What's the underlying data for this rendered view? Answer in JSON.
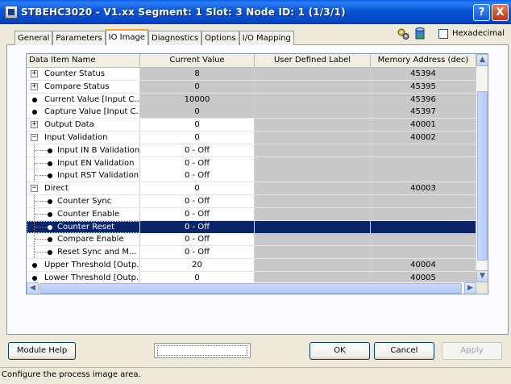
{
  "window": {
    "title": "STBEHC3020 - V1.xx Segment: 1 Slot: 3 Node ID: 1 (1/3/1)",
    "help_button": "?",
    "close_button": "X"
  },
  "tabs": [
    {
      "label": "General",
      "active": false
    },
    {
      "label": "Parameters",
      "active": false
    },
    {
      "label": "IO Image",
      "active": true
    },
    {
      "label": "Diagnostics",
      "active": false
    },
    {
      "label": "Options",
      "active": false
    },
    {
      "label": "I/O Mapping",
      "active": false
    }
  ],
  "toolbar": {
    "hexadecimal_label": "Hexadecimal",
    "hexadecimal_checked": false
  },
  "grid": {
    "columns": [
      "Data Item Name",
      "Current Value",
      "User Defined Label",
      "Memory Address (dec)"
    ],
    "rows": [
      {
        "name": "Counter Status",
        "value": "8",
        "label": "",
        "address": "45394",
        "kind": "expand",
        "value_shaded": true
      },
      {
        "name": "Compare Status",
        "value": "0",
        "label": "",
        "address": "45395",
        "kind": "expand",
        "value_shaded": true
      },
      {
        "name": "Current Value [Input C...",
        "value": "10000",
        "label": "",
        "address": "45396",
        "kind": "bullet",
        "value_shaded": true
      },
      {
        "name": "Capture Value [Input C...",
        "value": "0",
        "label": "",
        "address": "45397",
        "kind": "bullet",
        "value_shaded": true
      },
      {
        "name": "Output Data",
        "value": "0",
        "label": "",
        "address": "40001",
        "kind": "expand",
        "value_shaded": false
      },
      {
        "name": "Input Validation",
        "value": "0",
        "label": "",
        "address": "40002",
        "kind": "collapse",
        "value_shaded": false
      },
      {
        "name": "Input IN B Validation",
        "value": "0 - Off",
        "label": "",
        "address": "",
        "kind": "child",
        "value_shaded": false
      },
      {
        "name": "Input EN Validation",
        "value": "0 - Off",
        "label": "",
        "address": "",
        "kind": "child",
        "value_shaded": false
      },
      {
        "name": "Input RST Validation",
        "value": "0 - Off",
        "label": "",
        "address": "",
        "kind": "child",
        "value_shaded": false
      },
      {
        "name": "Direct",
        "value": "0",
        "label": "",
        "address": "40003",
        "kind": "collapse",
        "value_shaded": false
      },
      {
        "name": "Counter Sync",
        "value": "0 - Off",
        "label": "",
        "address": "",
        "kind": "child",
        "value_shaded": false
      },
      {
        "name": "Counter Enable",
        "value": "0 - Off",
        "label": "",
        "address": "",
        "kind": "child",
        "value_shaded": false
      },
      {
        "name": "Counter Reset",
        "value": "0 - Off",
        "label": "",
        "address": "",
        "kind": "child",
        "value_shaded": false,
        "selected": true
      },
      {
        "name": "Compare Enable",
        "value": "0 - Off",
        "label": "",
        "address": "",
        "kind": "child",
        "value_shaded": false
      },
      {
        "name": "Reset Sync and M...",
        "value": "0 - Off",
        "label": "",
        "address": "",
        "kind": "child",
        "value_shaded": false
      },
      {
        "name": "Upper Threshold [Outp...",
        "value": "20",
        "label": "",
        "address": "40004",
        "kind": "bullet",
        "value_shaded": false
      },
      {
        "name": "Lower Threshold [Outp...",
        "value": "0",
        "label": "",
        "address": "40005",
        "kind": "bullet",
        "value_shaded": false
      }
    ]
  },
  "buttons": {
    "module_help": "Module Help",
    "ok": "OK",
    "cancel": "Cancel",
    "apply": "Apply"
  },
  "status_text": "Configure the process image area."
}
